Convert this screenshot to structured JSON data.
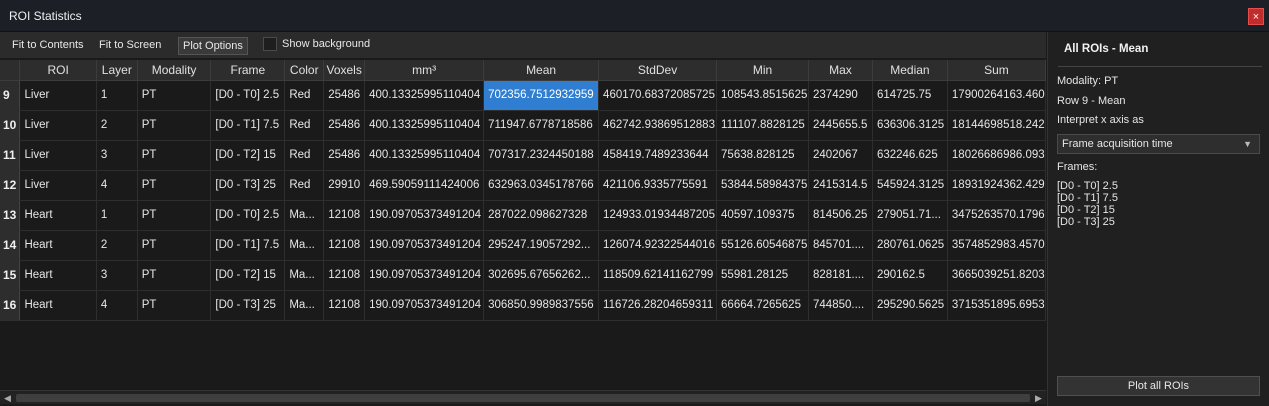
{
  "window": {
    "title": "ROI Statistics",
    "close_glyph": "×"
  },
  "toolbar": {
    "fit_contents": "Fit to Contents",
    "fit_screen": "Fit to Screen",
    "plot_options": "Plot Options",
    "show_background": "Show background"
  },
  "table": {
    "columns": [
      "ROI",
      "Layer",
      "Modality",
      "Frame",
      "Color",
      "Voxels",
      "mm³",
      "Mean",
      "StdDev",
      "Min",
      "Max",
      "Median",
      "Sum"
    ],
    "rows": [
      {
        "num": "9",
        "cells": [
          "Liver",
          "1",
          "PT",
          "[D0 - T0] 2.5",
          "Red",
          "25486",
          "400.13325995110404",
          "702356.7512932959",
          "460170.68372085725",
          "108543.8515625",
          "2374290",
          "614725.75",
          "17900264163.460"
        ]
      },
      {
        "num": "10",
        "cells": [
          "Liver",
          "2",
          "PT",
          "[D0 - T1] 7.5",
          "Red",
          "25486",
          "400.13325995110404",
          "711947.6778718586",
          "462742.93869512883",
          "111107.8828125",
          "2445655.5",
          "636306.3125",
          "18144698518.242"
        ]
      },
      {
        "num": "11",
        "cells": [
          "Liver",
          "3",
          "PT",
          "[D0 - T2] 15",
          "Red",
          "25486",
          "400.13325995110404",
          "707317.2324450188",
          "458419.7489233644",
          "75638.828125",
          "2402067",
          "632246.625",
          "18026686986.093"
        ]
      },
      {
        "num": "12",
        "cells": [
          "Liver",
          "4",
          "PT",
          "[D0 - T3] 25",
          "Red",
          "29910",
          "469.59059111424006",
          "632963.0345178766",
          "421106.9335775591",
          "53844.58984375",
          "2415314.5",
          "545924.3125",
          "18931924362.429"
        ]
      },
      {
        "num": "13",
        "cells": [
          "Heart",
          "1",
          "PT",
          "[D0 - T0] 2.5",
          "Ma...",
          "12108",
          "190.09705373491204",
          "287022.098627328",
          "124933.01934487205",
          "40597.109375",
          "814506.25",
          "279051.71...",
          "3475263570.1796"
        ]
      },
      {
        "num": "14",
        "cells": [
          "Heart",
          "2",
          "PT",
          "[D0 - T1] 7.5",
          "Ma...",
          "12108",
          "190.09705373491204",
          "295247.19057292...",
          "126074.92322544016",
          "55126.60546875",
          "845701....",
          "280761.0625",
          "3574852983.4570"
        ]
      },
      {
        "num": "15",
        "cells": [
          "Heart",
          "3",
          "PT",
          "[D0 - T2] 15",
          "Ma...",
          "12108",
          "190.09705373491204",
          "302695.67656262...",
          "118509.62141162799",
          "55981.28125",
          "828181....",
          "290162.5",
          "3665039251.8203"
        ]
      },
      {
        "num": "16",
        "cells": [
          "Heart",
          "4",
          "PT",
          "[D0 - T3] 25",
          "Ma...",
          "12108",
          "190.09705373491204",
          "306850.9989837556",
          "116726.28204659311",
          "66664.7265625",
          "744850....",
          "295290.5625",
          "3715351895.6953"
        ]
      }
    ],
    "selected": {
      "row": 0,
      "col": 7
    }
  },
  "side": {
    "heading": "All ROIs - Mean",
    "modality": "Modality: PT",
    "row_info": "Row 9 - Mean",
    "interpret": "Interpret x axis as",
    "select_value": "Frame acquisition time",
    "frames_label": "Frames:",
    "frames": [
      "[D0 - T0] 2.5",
      "[D0 - T1] 7.5",
      "[D0 - T2] 15",
      "[D0 - T3] 25"
    ],
    "plot_all": "Plot all ROIs"
  },
  "colors": {
    "selection": "#2f7ed1",
    "close": "#c42b2b"
  },
  "icons": {
    "close": "close-icon",
    "dropdown": "chevron-down-icon",
    "scroll_left": "arrow-left-icon",
    "scroll_right": "arrow-right-icon"
  }
}
